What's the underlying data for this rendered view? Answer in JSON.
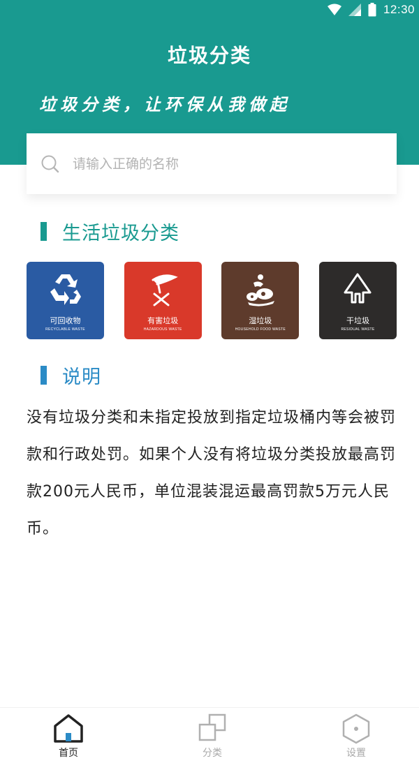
{
  "status_bar": {
    "time": "12:30"
  },
  "header": {
    "title": "垃圾分类",
    "slogan": "垃圾分类，让环保从我做起"
  },
  "search": {
    "placeholder": "请输入正确的名称"
  },
  "sections": {
    "categories_title": "生活垃圾分类",
    "description_title": "说明"
  },
  "categories": [
    {
      "name": "可回收物",
      "name_en": "RECYCLABLE WASTE",
      "color": "#2a5ba3",
      "icon": "recycle-icon"
    },
    {
      "name": "有害垃圾",
      "name_en": "HAZARDOUS WASTE",
      "color": "#d9392a",
      "icon": "hazard-icon"
    },
    {
      "name": "湿垃圾",
      "name_en": "HOUSEHOLD FOOD WASTE",
      "color": "#5e3b2c",
      "icon": "food-waste-icon"
    },
    {
      "name": "干垃圾",
      "name_en": "RESIDUAL WASTE",
      "color": "#2d2b2a",
      "icon": "residual-waste-icon"
    }
  ],
  "description": {
    "text": "没有垃圾分类和未指定投放到指定垃圾桶内等会被罚款和行政处罚。如果个人没有将垃圾分类投放最高罚款200元人民币，单位混装混运最高罚款5万元人民币。"
  },
  "bottom_nav": {
    "items": [
      {
        "label": "首页",
        "icon": "home-icon",
        "active": true
      },
      {
        "label": "分类",
        "icon": "category-icon",
        "active": false
      },
      {
        "label": "设置",
        "icon": "settings-icon",
        "active": false
      }
    ]
  },
  "colors": {
    "primary": "#199a90",
    "section_bar_1": "#199a90",
    "section_bar_2": "#2b8bc6",
    "section_text": "#199a90",
    "section_text_2": "#2b8bc6",
    "nav_active": "#222222",
    "nav_inactive": "#aaaaaa"
  }
}
